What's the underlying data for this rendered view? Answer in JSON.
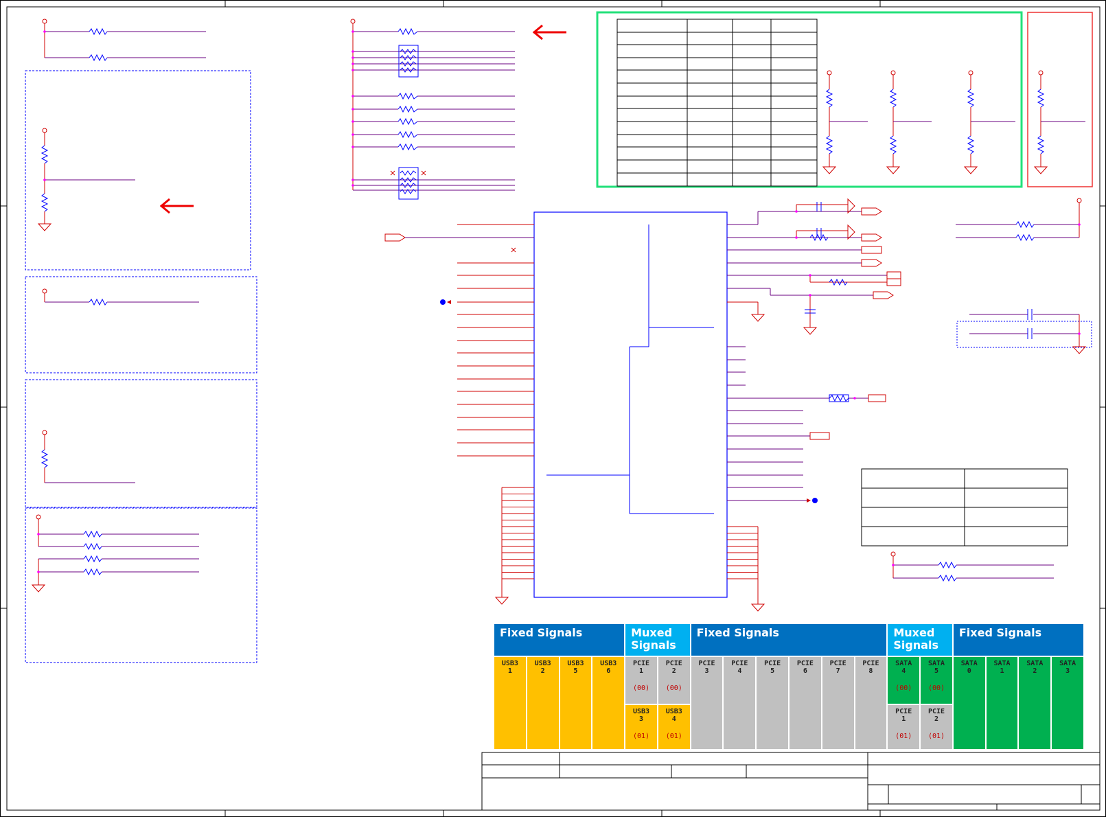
{
  "colors": {
    "wire": "#d00000",
    "net": "#6a0080",
    "component": "#0000ff",
    "junction": "#ff00ff",
    "highlight_box": "#22e07a",
    "fixed_header": "#0070c0",
    "muxed_header": "#00b0f0",
    "usb_cell": "#ffc000",
    "pcie_cell": "#c0c0c0",
    "sata_cell": "#00b050"
  },
  "icons": [
    "arrow-left-icon",
    "resistor-icon",
    "capacitor-icon",
    "ground-icon",
    "connector-icon"
  ],
  "signal_table": {
    "headers": [
      {
        "label": "Fixed Signals",
        "kind": "fixed",
        "span": 4
      },
      {
        "label": "Muxed Signals",
        "kind": "muxed",
        "span": 2
      },
      {
        "label": "Fixed Signals",
        "kind": "fixed",
        "span": 6
      },
      {
        "label": "Muxed Signals",
        "kind": "muxed",
        "span": 2
      },
      {
        "label": "Fixed Signals",
        "kind": "fixed",
        "span": 4
      }
    ],
    "columns": [
      {
        "top": {
          "name": "USB3",
          "num": "1",
          "code": "",
          "kind": "usb"
        }
      },
      {
        "top": {
          "name": "USB3",
          "num": "2",
          "code": "",
          "kind": "usb"
        }
      },
      {
        "top": {
          "name": "USB3",
          "num": "5",
          "code": "",
          "kind": "usb"
        }
      },
      {
        "top": {
          "name": "USB3",
          "num": "6",
          "code": "",
          "kind": "usb"
        }
      },
      {
        "top": {
          "name": "PCIE",
          "num": "1",
          "code": "(00)",
          "kind": "pcie"
        },
        "bottom": {
          "name": "USB3",
          "num": "3",
          "code": "(01)",
          "kind": "usb"
        }
      },
      {
        "top": {
          "name": "PCIE",
          "num": "2",
          "code": "(00)",
          "kind": "pcie"
        },
        "bottom": {
          "name": "USB3",
          "num": "4",
          "code": "(01)",
          "kind": "usb"
        }
      },
      {
        "top": {
          "name": "PCIE",
          "num": "3",
          "code": "",
          "kind": "pcie"
        }
      },
      {
        "top": {
          "name": "PCIE",
          "num": "4",
          "code": "",
          "kind": "pcie"
        }
      },
      {
        "top": {
          "name": "PCIE",
          "num": "5",
          "code": "",
          "kind": "pcie"
        }
      },
      {
        "top": {
          "name": "PCIE",
          "num": "6",
          "code": "",
          "kind": "pcie"
        }
      },
      {
        "top": {
          "name": "PCIE",
          "num": "7",
          "code": "",
          "kind": "pcie"
        }
      },
      {
        "top": {
          "name": "PCIE",
          "num": "8",
          "code": "",
          "kind": "pcie"
        }
      },
      {
        "top": {
          "name": "SATA",
          "num": "4",
          "code": "(00)",
          "kind": "sata"
        },
        "bottom": {
          "name": "PCIE",
          "num": "1",
          "code": "(01)",
          "kind": "pcie"
        }
      },
      {
        "top": {
          "name": "SATA",
          "num": "5",
          "code": "(00)",
          "kind": "sata"
        },
        "bottom": {
          "name": "PCIE",
          "num": "2",
          "code": "(01)",
          "kind": "pcie"
        }
      },
      {
        "top": {
          "name": "SATA",
          "num": "0",
          "code": "",
          "kind": "sata"
        }
      },
      {
        "top": {
          "name": "SATA",
          "num": "1",
          "code": "",
          "kind": "sata"
        }
      },
      {
        "top": {
          "name": "SATA",
          "num": "2",
          "code": "",
          "kind": "sata"
        }
      },
      {
        "top": {
          "name": "SATA",
          "num": "3",
          "code": "",
          "kind": "sata"
        }
      }
    ]
  }
}
